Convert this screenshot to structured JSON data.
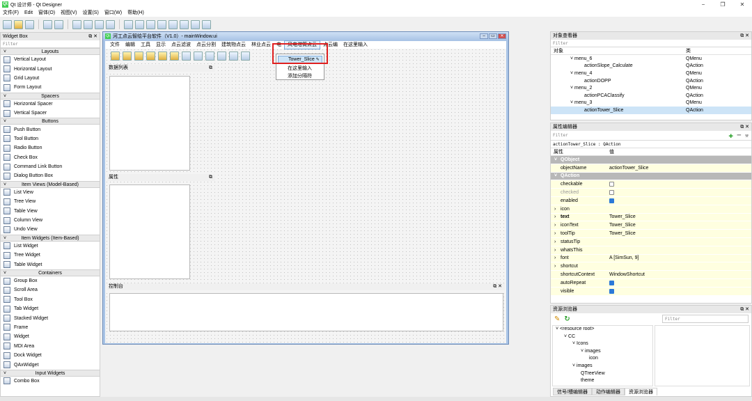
{
  "app": {
    "title": "Qt 设计师 - Qt Designer",
    "logo": "Qt",
    "window_controls": [
      "−",
      "❐",
      "✕"
    ]
  },
  "menubar": [
    "文件(F)",
    "Edit",
    "窗体(O)",
    "视图(V)",
    "设置(S)",
    "窗口(W)",
    "帮助(H)"
  ],
  "widget_box": {
    "title": "Widget Box",
    "filter_placeholder": "Filter",
    "sections": [
      {
        "name": "Layouts",
        "items": [
          "Vertical Layout",
          "Horizontal Layout",
          "Grid Layout",
          "Form Layout"
        ]
      },
      {
        "name": "Spacers",
        "items": [
          "Horizontal Spacer",
          "Vertical Spacer"
        ]
      },
      {
        "name": "Buttons",
        "items": [
          "Push Button",
          "Tool Button",
          "Radio Button",
          "Check Box",
          "Command Link Button",
          "Dialog Button Box"
        ]
      },
      {
        "name": "Item Views (Model-Based)",
        "items": [
          "List View",
          "Tree View",
          "Table View",
          "Column View",
          "Undo View"
        ]
      },
      {
        "name": "Item Widgets (Item-Based)",
        "items": [
          "List Widget",
          "Tree Widget",
          "Table Widget"
        ]
      },
      {
        "name": "Containers",
        "items": [
          "Group Box",
          "Scroll Area",
          "Tool Box",
          "Tab Widget",
          "Stacked Widget",
          "Frame",
          "Widget",
          "MDI Area",
          "Dock Widget",
          "QAxWidget"
        ]
      },
      {
        "name": "Input Widgets",
        "items": [
          "Combo Box"
        ]
      }
    ]
  },
  "main_window": {
    "title": "河工点云智绘平台软件（V1.0）- mainWindow.ui",
    "menus": [
      "文件",
      "编辑",
      "工具",
      "显示",
      "点云滤波",
      "点云分割",
      "建筑物点云",
      "林业点云",
      "电",
      "风电塔筒点云",
      "点云编",
      "在这里输入"
    ],
    "popup": {
      "selected": "Tower_Slice",
      "items": [
        "在这里输入",
        "添加分隔符"
      ]
    },
    "dock_data": "数据列表",
    "dock_props": "属性",
    "dock_console": "控制台"
  },
  "object_inspector": {
    "title": "对象查看器",
    "filter_placeholder": "Filter",
    "headers": [
      "对象",
      "类"
    ],
    "rows": [
      {
        "name": "menu_6",
        "cls": "QMenu",
        "level": 1
      },
      {
        "name": "actionSlope_Calculate",
        "cls": "QAction",
        "level": 2
      },
      {
        "name": "menu_4",
        "cls": "QMenu",
        "level": 1
      },
      {
        "name": "actionDOPP",
        "cls": "QAction",
        "level": 2
      },
      {
        "name": "menu_2",
        "cls": "QMenu",
        "level": 1
      },
      {
        "name": "actionPCAClassify",
        "cls": "QAction",
        "level": 2
      },
      {
        "name": "menu_3",
        "cls": "QMenu",
        "level": 1
      },
      {
        "name": "actionTower_Slice",
        "cls": "QAction",
        "level": 2
      }
    ]
  },
  "property_editor": {
    "title": "属性编辑器",
    "filter_placeholder": "Filter",
    "context": "actionTower_Slice : QAction",
    "headers": [
      "属性",
      "值"
    ],
    "rows": [
      {
        "prop": "QObject",
        "val": "",
        "kind": "group"
      },
      {
        "prop": "objectName",
        "val": "actionTower_Slice",
        "kind": "text"
      },
      {
        "prop": "QAction",
        "val": "",
        "kind": "group"
      },
      {
        "prop": "checkable",
        "val": "",
        "kind": "unchecked"
      },
      {
        "prop": "checked",
        "val": "",
        "kind": "unchecked"
      },
      {
        "prop": "enabled",
        "val": "",
        "kind": "checked"
      },
      {
        "prop": "icon",
        "val": "",
        "kind": "expand"
      },
      {
        "prop": "text",
        "val": "Tower_Slice",
        "kind": "expand"
      },
      {
        "prop": "iconText",
        "val": "Tower_Slice",
        "kind": "expand"
      },
      {
        "prop": "toolTip",
        "val": "Tower_Slice",
        "kind": "expand"
      },
      {
        "prop": "statusTip",
        "val": "",
        "kind": "expand"
      },
      {
        "prop": "whatsThis",
        "val": "",
        "kind": "expand"
      },
      {
        "prop": "font",
        "val": "A  [SimSun, 9]",
        "kind": "expand"
      },
      {
        "prop": "shortcut",
        "val": "",
        "kind": "expand"
      },
      {
        "prop": "shortcutContext",
        "val": "WindowShortcut",
        "kind": "text"
      },
      {
        "prop": "autoRepeat",
        "val": "",
        "kind": "checked"
      },
      {
        "prop": "visible",
        "val": "",
        "kind": "checked"
      }
    ]
  },
  "resource_browser": {
    "title": "资源浏览器",
    "filter_placeholder": "Filter",
    "tree": [
      {
        "label": "<resource root>",
        "level": 0
      },
      {
        "label": "CC",
        "level": 1
      },
      {
        "label": "Icons",
        "level": 2
      },
      {
        "label": "images",
        "level": 3
      },
      {
        "label": "icon",
        "level": 4
      },
      {
        "label": "images",
        "level": 2
      },
      {
        "label": "QTreeView",
        "level": 3
      },
      {
        "label": "theme",
        "level": 3
      }
    ]
  },
  "bottom_tabs": [
    "信号/槽编辑器",
    "动作编辑器",
    "资源浏览器"
  ],
  "colors": {
    "selection": "#cde4f7",
    "group_row": "#b8b8b8",
    "prop_row": "#ffffe0",
    "highlight_box": "#e02020"
  }
}
